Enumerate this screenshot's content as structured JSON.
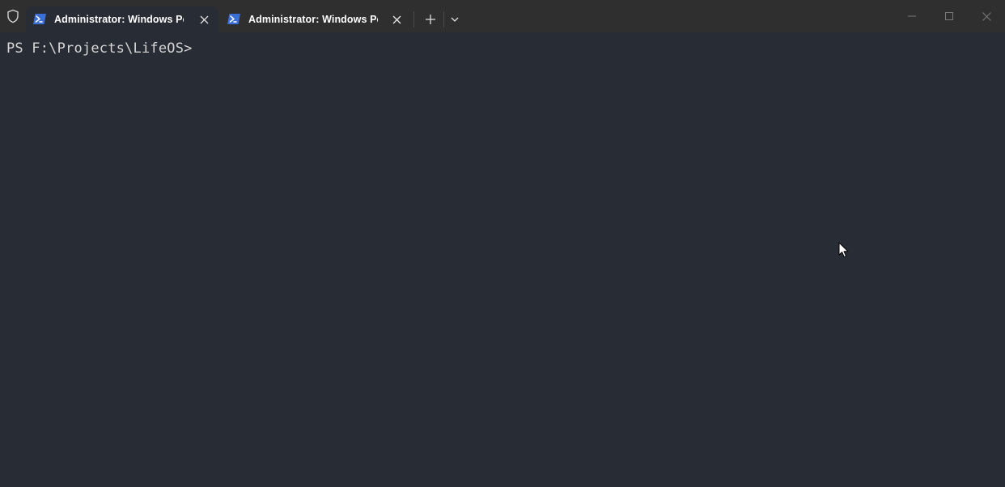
{
  "tabs": [
    {
      "title": "Administrator: Windows PowerShell",
      "active": true,
      "icon": "powershell-icon"
    },
    {
      "title": "Administrator: Windows PowerShell",
      "active": false,
      "icon": "powershell-icon"
    }
  ],
  "toolbar": {
    "new_tab_icon": "plus-icon",
    "dropdown_icon": "chevron-down-icon"
  },
  "window_controls": [
    "minimize-icon",
    "maximize-icon",
    "close-icon"
  ],
  "terminal": {
    "prompt": "PS F:\\Projects\\LifeOS>"
  },
  "colors": {
    "background": "#282c34",
    "titlebar": "#2f2f2f",
    "ps_icon": "#3a6fd8",
    "text": "#d6d6d6"
  }
}
